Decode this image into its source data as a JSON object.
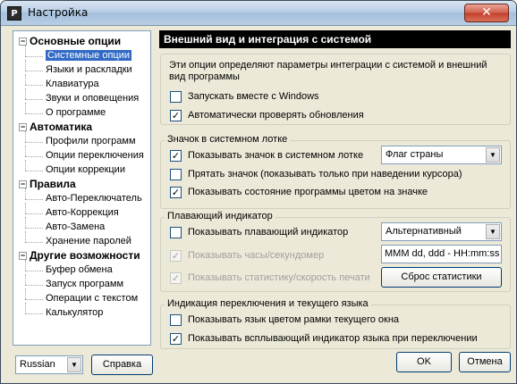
{
  "window": {
    "title": "Настройка",
    "close_label": "✕"
  },
  "tree": [
    {
      "label": "Основные опции",
      "bold": true,
      "expander": "−"
    },
    {
      "label": "Системные опции",
      "selected": true
    },
    {
      "label": "Языки и раскладки"
    },
    {
      "label": "Клавиатура"
    },
    {
      "label": "Звуки и оповещения"
    },
    {
      "label": "О программе"
    },
    {
      "label": "Автоматика",
      "bold": true,
      "expander": "−"
    },
    {
      "label": "Профили программ"
    },
    {
      "label": "Опции переключения"
    },
    {
      "label": "Опции коррекции"
    },
    {
      "label": "Правила",
      "bold": true,
      "expander": "−"
    },
    {
      "label": "Авто-Переключатель"
    },
    {
      "label": "Авто-Коррекция"
    },
    {
      "label": "Авто-Замена"
    },
    {
      "label": "Хранение паролей"
    },
    {
      "label": "Другие возможности",
      "bold": true,
      "expander": "−"
    },
    {
      "label": "Буфер обмена"
    },
    {
      "label": "Запуск программ"
    },
    {
      "label": "Операции с текстом"
    },
    {
      "label": "Калькулятор"
    }
  ],
  "panel": {
    "header": "Внешний вид и интеграция с системой",
    "intro_line1": "Эти опции определяют параметры интеграции с системой и внешний",
    "intro_line2": "вид программы",
    "run_with_windows": {
      "label": "Запускать вместе с Windows",
      "checked": false
    },
    "auto_update": {
      "label": "Автоматически проверять обновления",
      "checked": true
    },
    "tray_group": {
      "title": "Значок в системном лотке",
      "show_icon": {
        "label": "Показывать значок в системном лотке",
        "checked": true
      },
      "icon_style": "Флаг страны",
      "hide_icon": {
        "label": "Прятать значок (показывать только при наведении курсора)",
        "checked": false
      },
      "show_state_color": {
        "label": "Показывать состояние программы цветом на значке",
        "checked": true
      }
    },
    "float_group": {
      "title": "Плавающий индикатор",
      "show_indicator": {
        "label": "Показывать плавающий индикатор",
        "checked": false
      },
      "indicator_style": "Альтернативный",
      "show_clock": {
        "label": "Показывать часы/секундомер",
        "checked": true
      },
      "clock_format": "MMM dd, ddd - HH:mm:ss",
      "show_stats": {
        "label": "Показывать статистику/скорость печати",
        "checked": true
      },
      "reset_stats_label": "Сброс статистики"
    },
    "lang_group": {
      "title": "Индикация переключения и текущего языка",
      "frame_color": {
        "label": "Показывать язык цветом рамки текущего окна",
        "checked": false
      },
      "popup_indicator": {
        "label": "Показывать всплывающий индикатор языка при переключении",
        "checked": true
      }
    }
  },
  "footer": {
    "language": "Russian",
    "help_label": "Справка",
    "ok_label": "OK",
    "cancel_label": "Отмена"
  }
}
